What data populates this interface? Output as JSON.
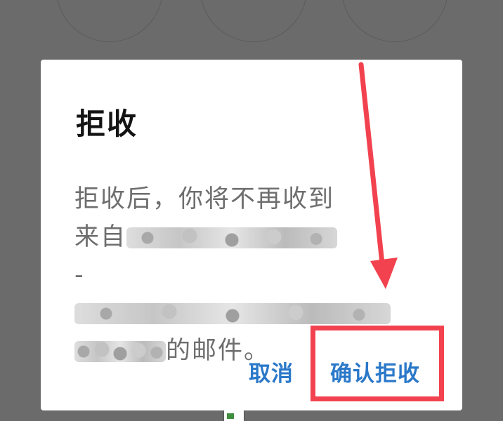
{
  "dialog": {
    "title": "拒收",
    "message_line1": "拒收后，你将不再收到",
    "message_line2_prefix": "来自",
    "message_dash": "-",
    "message_suffix": "的邮件。",
    "cancel_label": "取消",
    "confirm_label": "确认拒收"
  },
  "annotation": {
    "highlight_color": "#f2424f"
  },
  "colors": {
    "overlay": "#6b6b6b",
    "title": "#141414",
    "message": "#6e6e6e",
    "button": "#2a78c9"
  }
}
